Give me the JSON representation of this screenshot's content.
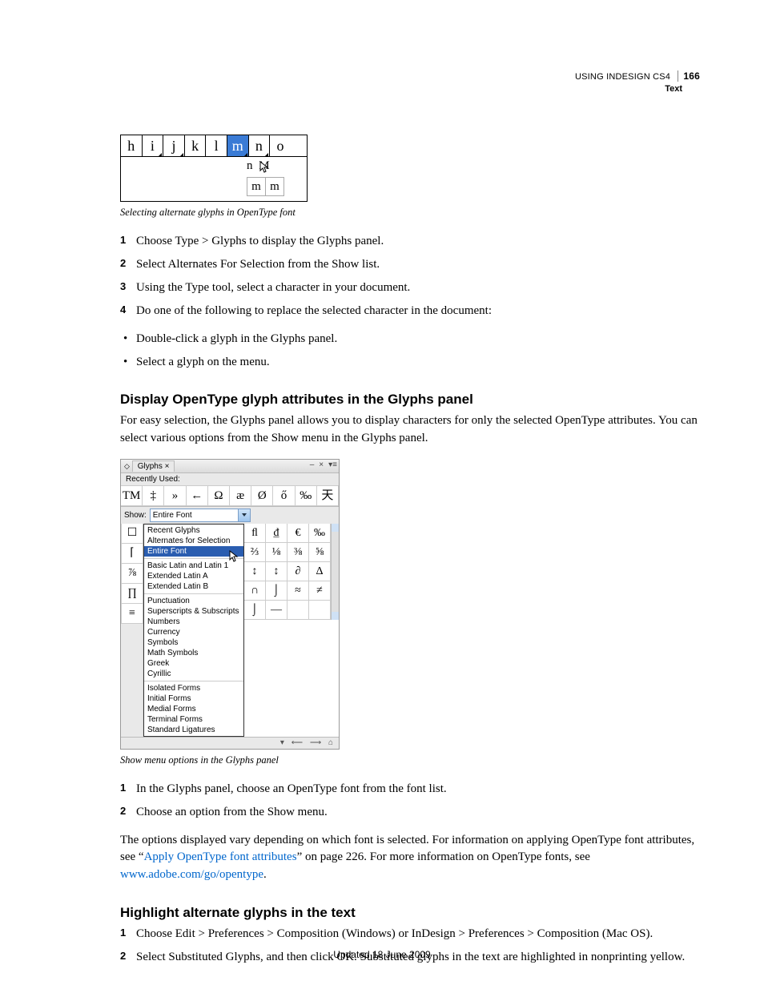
{
  "header": {
    "product": "USING INDESIGN CS4",
    "section": "Text",
    "page_number": "166"
  },
  "figure1": {
    "row": [
      "h",
      "i",
      "j",
      "k",
      "l",
      "m",
      "n",
      "o"
    ],
    "selected_index": 5,
    "popup_text": "n   M",
    "mini": [
      "m",
      "m"
    ],
    "caption": "Selecting alternate glyphs in OpenType font"
  },
  "steps1": [
    "Choose Type > Glyphs to display the Glyphs panel.",
    "Select Alternates For Selection from the Show list.",
    "Using the Type tool, select a character in your document.",
    "Do one of the following to replace the selected character in the document:"
  ],
  "bullets1": [
    "Double-click a glyph in the Glyphs panel.",
    "Select a glyph on the menu."
  ],
  "section2": {
    "heading": "Display OpenType glyph attributes in the Glyphs panel",
    "intro": "For easy selection, the Glyphs panel allows you to display characters for only the selected OpenType attributes. You can select various options from the Show menu in the Glyphs panel."
  },
  "figure2": {
    "tab": "Glyphs",
    "recently_used_label": "Recently Used:",
    "recent_glyphs": [
      "TM",
      "‡",
      "»",
      "←",
      "Ω",
      "æ",
      "Ø",
      "ő",
      "‰",
      "天"
    ],
    "show_label": "Show:",
    "show_value": "Entire Font",
    "left_glyphs": [
      "☐",
      "⌈",
      "⅞",
      "∏",
      "≡"
    ],
    "right_grid": [
      [
        "ﬂ",
        "₫",
        "€",
        "‰"
      ],
      [
        "⅔",
        "⅛",
        "⅜",
        "⅝"
      ],
      [
        "↕",
        "↕",
        "∂",
        "Δ"
      ],
      [
        "∩",
        "⌡",
        "≈",
        "≠"
      ],
      [
        "⌡",
        "—",
        "",
        ""
      ]
    ],
    "dropdown": {
      "recent": "Recent Glyphs",
      "alternates": "Alternates for Selection",
      "selected": "Entire Font",
      "groups": [
        [
          "Basic Latin and Latin 1",
          "Extended Latin A",
          "Extended Latin B"
        ],
        [
          "Punctuation",
          "Superscripts & Subscripts",
          "Numbers",
          "Currency",
          "Symbols",
          "Math Symbols",
          "Greek",
          "Cyrillic"
        ],
        [
          "Isolated Forms",
          "Initial Forms",
          "Medial Forms",
          "Terminal Forms",
          "Standard Ligatures"
        ]
      ]
    },
    "caption": "Show menu options in the Glyphs panel"
  },
  "steps2": [
    "In the Glyphs panel, choose an OpenType font from the font list.",
    "Choose an option from the Show menu."
  ],
  "paragraph_after_steps2": {
    "pre": "The options displayed vary depending on which font is selected. For information on applying OpenType font attributes, see “",
    "link1_text": "Apply OpenType font attributes",
    "mid": "” on page 226. For more information on OpenType fonts, see ",
    "link2_text": "www.adobe.com/go/opentype",
    "post": "."
  },
  "section3": {
    "heading": "Highlight alternate glyphs in the text",
    "steps": [
      "Choose Edit > Preferences > Composition (Windows) or InDesign > Preferences > Composition (Mac OS).",
      "Select Substituted Glyphs, and then click OK. Substituted glyphs in the text are highlighted in nonprinting yellow."
    ]
  },
  "footer": "Updated 18 June 2009"
}
